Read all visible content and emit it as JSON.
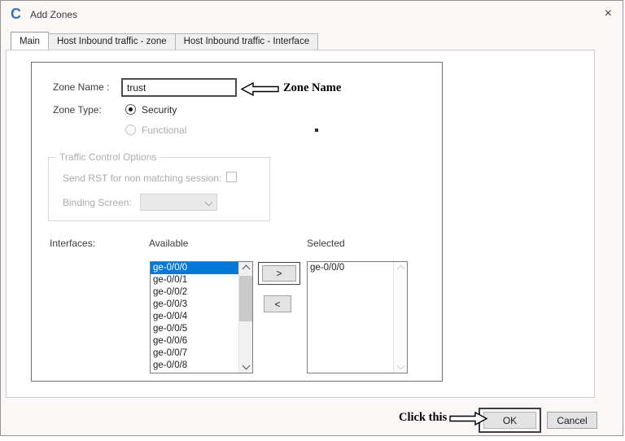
{
  "window": {
    "title": "Add Zones",
    "icon_letter": "C",
    "close_icon": "×"
  },
  "tabs": [
    {
      "label": "Main",
      "active": true
    },
    {
      "label": "Host Inbound traffic - zone",
      "active": false
    },
    {
      "label": "Host Inbound traffic - Interface",
      "active": false
    }
  ],
  "form": {
    "zone_name_label": "Zone Name :",
    "zone_name_value": "trust",
    "zone_type_label": "Zone Type:",
    "zone_type_options": [
      {
        "label": "Security",
        "selected": true,
        "enabled": true
      },
      {
        "label": "Functional",
        "selected": false,
        "enabled": false
      }
    ],
    "traffic_group": {
      "title": "Traffic Control Options",
      "send_rst_label": "Send RST for non matching session:",
      "send_rst_checked": false,
      "binding_screen_label": "Binding Screen:",
      "binding_screen_value": ""
    },
    "interfaces_label": "Interfaces:",
    "available_header": "Available",
    "selected_header": "Selected",
    "available_items": [
      "ge-0/0/0",
      "ge-0/0/1",
      "ge-0/0/2",
      "ge-0/0/3",
      "ge-0/0/4",
      "ge-0/0/5",
      "ge-0/0/6",
      "ge-0/0/7",
      "ge-0/0/8"
    ],
    "available_selected_index": 0,
    "selected_items": [
      "ge-0/0/0"
    ],
    "move_right_label": ">",
    "move_left_label": "<"
  },
  "annotations": {
    "zone_name": "Zone Name",
    "click_this": "Click this"
  },
  "footer": {
    "ok_label": "OK",
    "cancel_label": "Cancel"
  },
  "colors": {
    "selection": "#0078d7",
    "selection_text": "#ffffff",
    "icon_blue": "#3b73a9",
    "disabled_text": "#ababab"
  }
}
